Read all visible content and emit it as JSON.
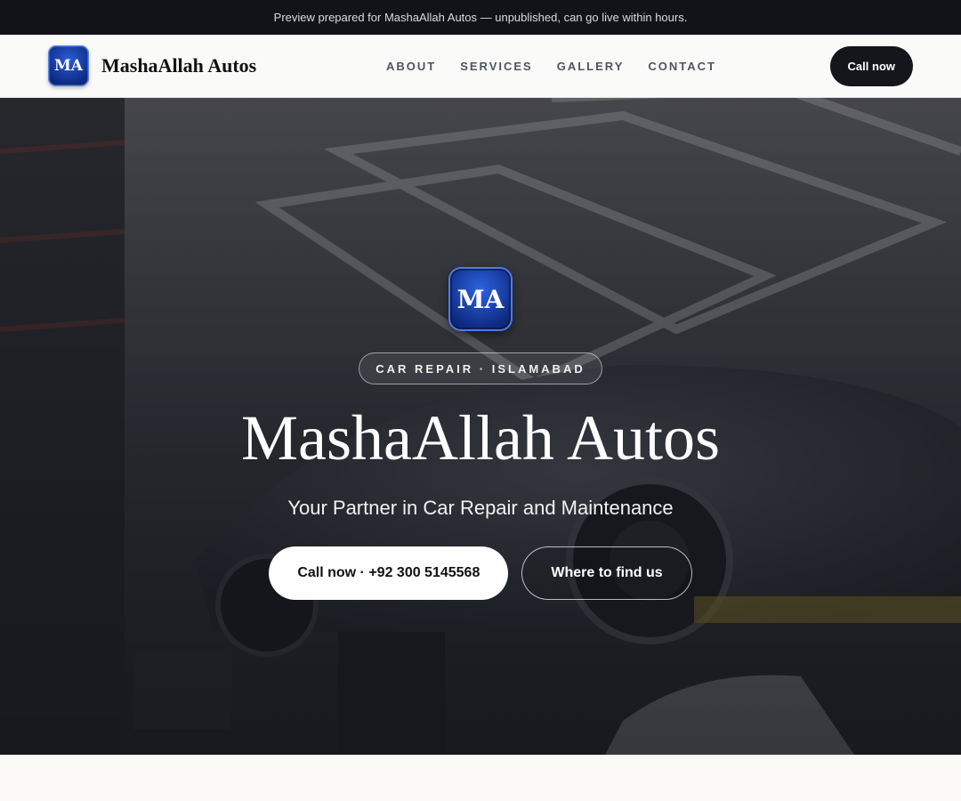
{
  "banner": {
    "text": "Preview prepared for MashaAllah Autos — unpublished, can go live within hours."
  },
  "header": {
    "logo_text": "MA",
    "brand_name": "MashaAllah Autos",
    "nav": [
      "ABOUT",
      "SERVICES",
      "GALLERY",
      "CONTACT"
    ],
    "cta_label": "Call now"
  },
  "hero": {
    "logo_text": "MA",
    "tag": "CAR REPAIR · ISLAMABAD",
    "title": "MashaAllah Autos",
    "subtitle": "Your Partner in Car Repair and Maintenance",
    "primary_button": "Call now · +92 300 5145568",
    "secondary_button": "Where to find us",
    "background_image": "garage-interior-photo"
  },
  "colors": {
    "topbar": "#111318",
    "logo_blue": "#0f2d86",
    "dark_button": "#14161c",
    "page_background": "#faf9f6"
  }
}
